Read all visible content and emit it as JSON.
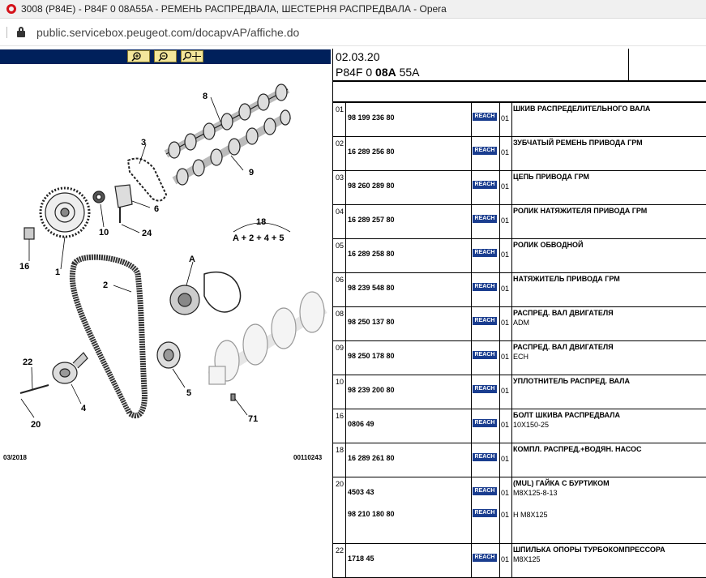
{
  "browser": {
    "window_title": "3008 (P84E) - P84F 0 08A55A - РЕМЕНЬ РАСПРЕДВАЛА, ШЕСТЕРНЯ РАСПРЕДВАЛА - Opera",
    "url": "public.servicebox.peugeot.com/docapvAP/affiche.do",
    "icons": [
      "opera-logo-icon",
      "lock-icon"
    ]
  },
  "viewer": {
    "buttons": [
      {
        "name": "zoom-in",
        "glyph": "🔍+"
      },
      {
        "name": "zoom-out",
        "glyph": "🔍−"
      },
      {
        "name": "zoom-fit",
        "glyph": "🔍✥"
      }
    ],
    "callouts": {
      "c8": "8",
      "c3": "3",
      "c9": "9",
      "c6": "6",
      "c10": "10",
      "c24": "24",
      "c18": "18",
      "c18formula": "A + 2 + 4 + 5",
      "c16": "16",
      "c1": "1",
      "cA": "A",
      "c2": "2",
      "c22": "22",
      "c5": "5",
      "c4": "4",
      "c20": "20",
      "c71": "71"
    },
    "footer_left": "03/2018",
    "footer_right": "00110243"
  },
  "header": {
    "date": "02.03.20",
    "ref_prefix": "P84F 0 ",
    "ref_bold": "08A",
    "ref_suffix": " 55A"
  },
  "parts": [
    {
      "no": "01",
      "ref": "98 199 236 80",
      "reach": "REACH",
      "qty": "01",
      "desc": "ШКИВ РАСПРЕДЕЛИТЕЛЬНОГО ВАЛА",
      "sub": ""
    },
    {
      "no": "02",
      "ref": "16 289 256 80",
      "reach": "REACH",
      "qty": "01",
      "desc": "ЗУБЧАТЫЙ РЕМЕНЬ ПРИВОДА ГРМ",
      "sub": ""
    },
    {
      "no": "03",
      "ref": "98 260 289 80",
      "reach": "REACH",
      "qty": "01",
      "desc": "ЦЕПЬ ПРИВОДА ГРМ",
      "sub": ""
    },
    {
      "no": "04",
      "ref": "16 289 257 80",
      "reach": "REACH",
      "qty": "01",
      "desc": "РОЛИК НАТЯЖИТЕЛЯ ПРИВОДА ГРМ",
      "sub": ""
    },
    {
      "no": "05",
      "ref": "16 289 258 80",
      "reach": "REACH",
      "qty": "01",
      "desc": "РОЛИК ОБВОДНОЙ",
      "sub": ""
    },
    {
      "no": "06",
      "ref": "98 239 548 80",
      "reach": "REACH",
      "qty": "01",
      "desc": "НАТЯЖИТЕЛЬ ПРИВОДА ГРМ",
      "sub": ""
    },
    {
      "no": "08",
      "ref": "98 250 137 80",
      "reach": "REACH",
      "qty": "01",
      "desc": "РАСПРЕД. ВАЛ ДВИГАТЕЛЯ",
      "sub": "ADM"
    },
    {
      "no": "09",
      "ref": "98 250 178 80",
      "reach": "REACH",
      "qty": "01",
      "desc": "РАСПРЕД. ВАЛ ДВИГАТЕЛЯ",
      "sub": "ECH"
    },
    {
      "no": "10",
      "ref": "98 239 200 80",
      "reach": "REACH",
      "qty": "01",
      "desc": "УПЛОТНИТЕЛЬ РАСПРЕД. ВАЛА",
      "sub": ""
    },
    {
      "no": "16",
      "ref": "0806 49",
      "reach": "REACH",
      "qty": "01",
      "desc": "БОЛТ ШКИВА РАСПРЕДВАЛА",
      "sub": "10X150-25"
    },
    {
      "no": "18",
      "ref": "16 289 261 80",
      "reach": "REACH",
      "qty": "01",
      "desc": "КОМПЛ. РАСПРЕД.+ВОДЯН. НАСОС",
      "sub": ""
    },
    {
      "no": "20",
      "ref": "4503 43",
      "reach": "REACH",
      "qty": "01",
      "desc": "(MUL) ГАЙКА С БУРТИКОМ",
      "sub": "M8X125-8-13",
      "ref2": "98 210 180 80",
      "reach2": "REACH",
      "qty2": "01",
      "sub2": "H M8X125"
    },
    {
      "no": "22",
      "ref": "1718 45",
      "reach": "REACH",
      "qty": "01",
      "desc": "ШПИЛЬКА ОПОРЫ ТУРБОКОМПРЕССОРА",
      "sub": "M8X125"
    }
  ]
}
